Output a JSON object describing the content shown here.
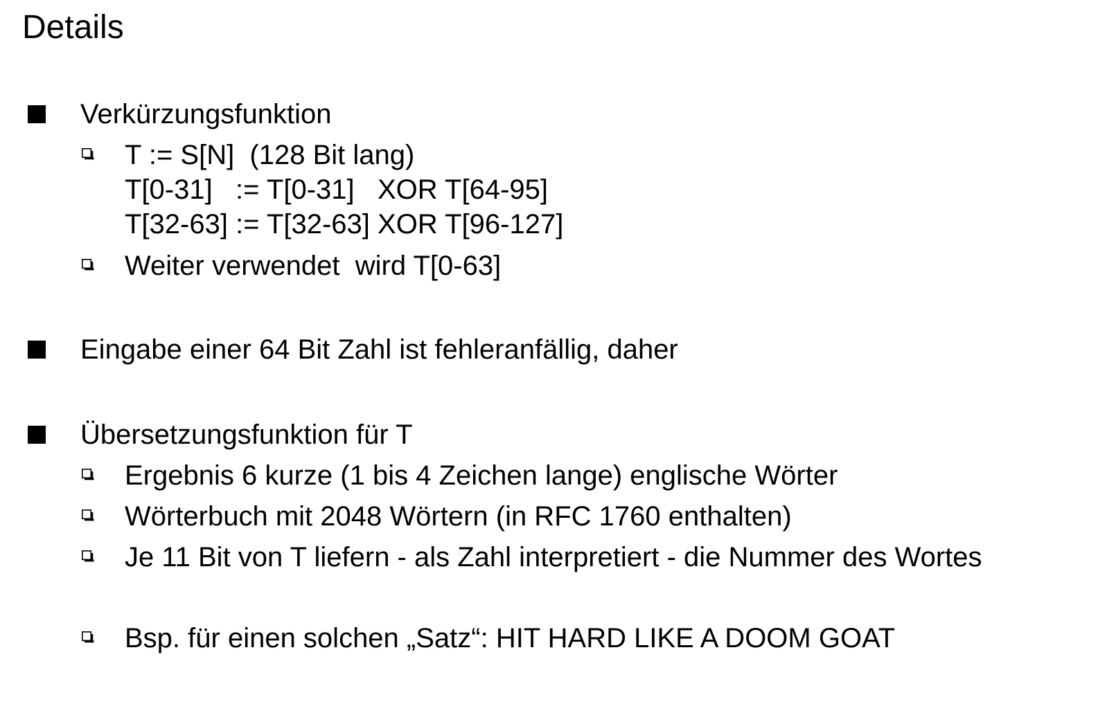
{
  "title": "Details",
  "items": [
    {
      "text": "Verkürzungsfunktion",
      "sub": [
        {
          "lines": [
            "T := S[N]  (128 Bit lang)",
            "T[0-31]   := T[0-31]   XOR T[64-95]",
            "T[32-63] := T[32-63] XOR T[96-127]"
          ]
        },
        {
          "lines": [
            "Weiter verwendet  wird T[0-63]"
          ]
        }
      ]
    },
    {
      "text": "Eingabe einer 64 Bit Zahl ist fehleranfällig, daher",
      "sub": []
    },
    {
      "text": "Übersetzungsfunktion für T",
      "sub": [
        {
          "lines": [
            "Ergebnis 6 kurze (1 bis 4 Zeichen lange) englische Wörter"
          ]
        },
        {
          "lines": [
            "Wörterbuch mit 2048 Wörtern (in RFC 1760 enthalten)"
          ]
        },
        {
          "lines": [
            "Je 11 Bit von T liefern - als Zahl interpretiert - die Nummer des Wortes"
          ]
        },
        {
          "lines": [
            "Bsp. für einen solchen „Satz“: HIT HARD LIKE A DOOM GOAT"
          ]
        }
      ]
    }
  ]
}
